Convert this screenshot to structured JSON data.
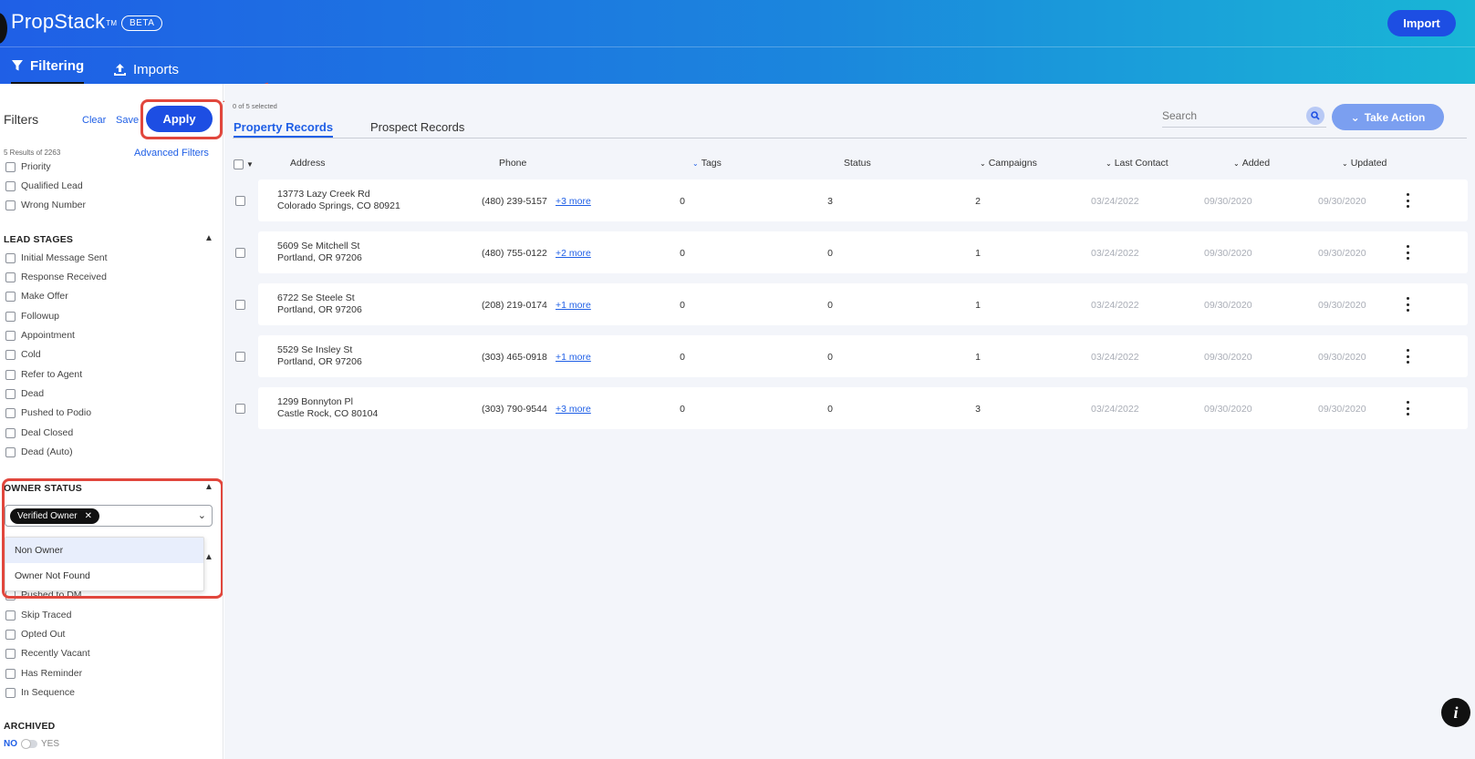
{
  "app": {
    "brand": "PropStack",
    "tm": "TM",
    "beta": "BETA",
    "import_label": "Import"
  },
  "nav": {
    "filtering": "Filtering",
    "imports": "Imports"
  },
  "sidebar": {
    "title": "Filters",
    "clear": "Clear",
    "save": "Save",
    "apply": "Apply",
    "results": "5 Results of 2263",
    "advanced": "Advanced Filters",
    "top_items": [
      "Priority",
      "Qualified Lead",
      "Wrong Number"
    ],
    "lead_stages_title": "LEAD STAGES",
    "lead_stages": [
      "Initial Message Sent",
      "Response Received",
      "Make Offer",
      "Followup",
      "Appointment",
      "Cold",
      "Refer to Agent",
      "Dead",
      "Pushed to Podio",
      "Deal Closed",
      "Dead (Auto)"
    ],
    "owner_status_title": "OWNER STATUS",
    "owner_selected_chip": "Verified Owner",
    "owner_options": [
      "Non Owner",
      "Owner Not Found"
    ],
    "other_items": [
      "Pushed to DM",
      "Skip Traced",
      "Opted Out",
      "Recently Vacant",
      "Has Reminder",
      "In Sequence"
    ],
    "archived_title": "ARCHIVED",
    "archived_no": "NO",
    "archived_yes": "YES"
  },
  "main": {
    "selected": "0 of 5 selected",
    "tabs": [
      "Property Records",
      "Prospect Records"
    ],
    "search_placeholder": "Search",
    "take_action": "Take Action",
    "columns": [
      "Address",
      "Phone",
      "Tags",
      "Status",
      "Campaigns",
      "Last Contact",
      "Added",
      "Updated"
    ],
    "rows": [
      {
        "street": "13773 Lazy Creek Rd",
        "city": "Colorado Springs, CO 80921",
        "phone": "(480) 239-5157",
        "more": "+3 more",
        "tags": "0",
        "status": "3",
        "campaigns": "2",
        "last_contact": "03/24/2022",
        "added": "09/30/2020",
        "updated": "09/30/2020"
      },
      {
        "street": "5609 Se Mitchell St",
        "city": "Portland, OR 97206",
        "phone": "(480) 755-0122",
        "more": "+2 more",
        "tags": "0",
        "status": "0",
        "campaigns": "1",
        "last_contact": "03/24/2022",
        "added": "09/30/2020",
        "updated": "09/30/2020"
      },
      {
        "street": "6722 Se Steele St",
        "city": "Portland, OR 97206",
        "phone": "(208) 219-0174",
        "more": "+1 more",
        "tags": "0",
        "status": "0",
        "campaigns": "1",
        "last_contact": "03/24/2022",
        "added": "09/30/2020",
        "updated": "09/30/2020"
      },
      {
        "street": "5529 Se Insley St",
        "city": "Portland, OR 97206",
        "phone": "(303) 465-0918",
        "more": "+1 more",
        "tags": "0",
        "status": "0",
        "campaigns": "1",
        "last_contact": "03/24/2022",
        "added": "09/30/2020",
        "updated": "09/30/2020"
      },
      {
        "street": "1299 Bonnyton Pl",
        "city": "Castle Rock, CO 80104",
        "phone": "(303) 790-9544",
        "more": "+3 more",
        "tags": "0",
        "status": "0",
        "campaigns": "3",
        "last_contact": "03/24/2022",
        "added": "09/30/2020",
        "updated": "09/30/2020"
      }
    ]
  },
  "info_icon": "i",
  "colors": {
    "primary": "#1d4ee3",
    "annotation": "#e1473d",
    "header_start": "#1f5fe6",
    "header_end": "#19b6d6"
  }
}
